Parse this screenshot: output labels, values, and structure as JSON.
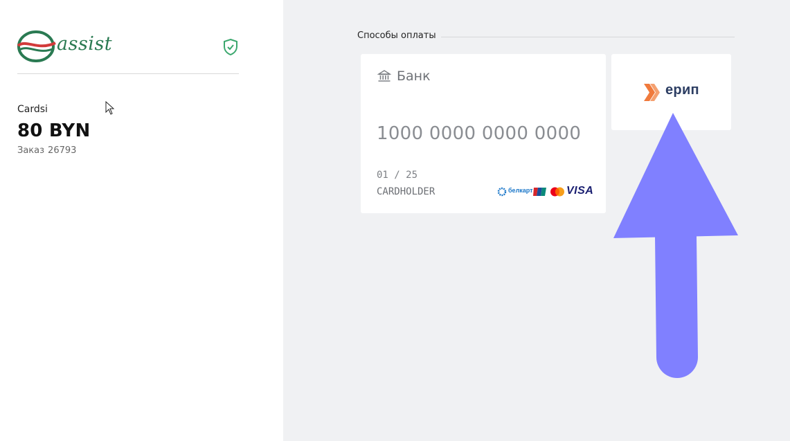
{
  "merchant": {
    "logo_text": "assist",
    "shop_name": "Cardsi",
    "amount": "80 BYN",
    "order_label": "Заказ",
    "order_number": "26793"
  },
  "payment_methods": {
    "section_title": "Способы оплаты",
    "bank_card": {
      "label": "Банк",
      "number_placeholder": "1000 0000 0000 0000",
      "expiry": "01 / 25",
      "holder": "CARDHOLDER",
      "brands": [
        "белкарт",
        "unionpay",
        "mastercard",
        "VISA"
      ]
    },
    "erip": {
      "label": "ерип"
    }
  },
  "colors": {
    "accent_green": "#2a7a52",
    "panel_bg": "#f0f1f3",
    "arrow": "#8080ff",
    "erip_orange": "#f07a3c",
    "erip_navy": "#2d3e63"
  },
  "icons": {
    "shield": "shield-check-icon",
    "bank": "bank-building-icon",
    "cursor": "mouse-pointer-icon"
  }
}
